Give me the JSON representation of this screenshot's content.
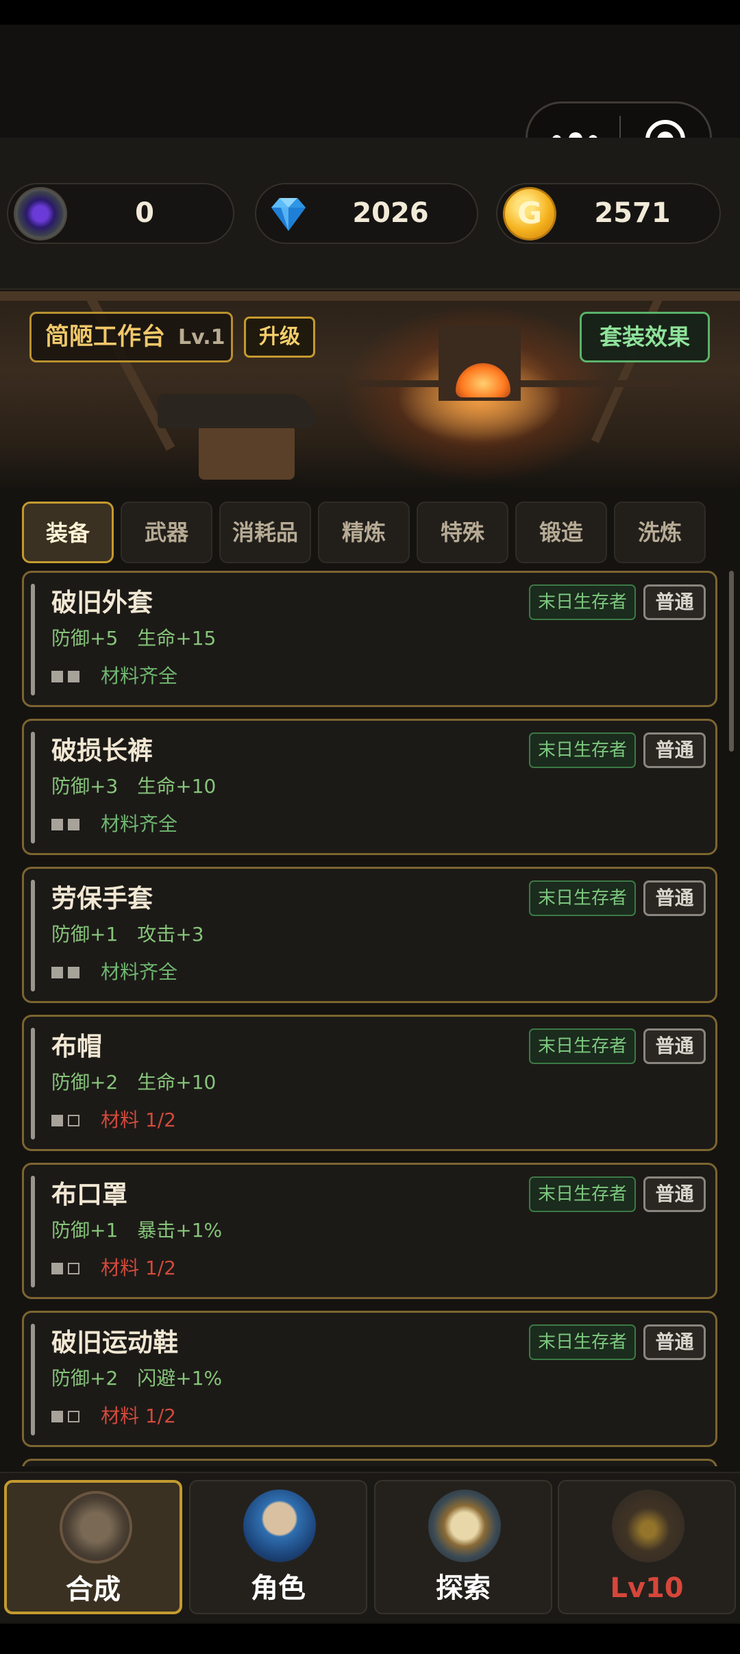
{
  "colors": {
    "accent_gold": "#c49a2f",
    "set_green": "#5ab36a",
    "stat_green": "#86c47a",
    "lack_red": "#d14a3c"
  },
  "resources": [
    {
      "icon": "crystal-icon",
      "value": "0"
    },
    {
      "icon": "diamond-icon",
      "value": "2026"
    },
    {
      "icon": "gold-coin-icon",
      "value": "2571",
      "glyph": "G"
    }
  ],
  "workbench": {
    "name": "简陋工作台",
    "level": "Lv.1",
    "upgrade_label": "升级",
    "set_effect_label": "套装效果"
  },
  "tabs": [
    "装备",
    "武器",
    "消耗品",
    "精炼",
    "特殊",
    "锻造",
    "洗炼"
  ],
  "active_tab": 0,
  "items": [
    {
      "name": "破旧外套",
      "stats": [
        "防御+5",
        "生命+15"
      ],
      "materials": "材料齐全",
      "filled": 2,
      "set": "末日生存者",
      "grade": "普通"
    },
    {
      "name": "破损长裤",
      "stats": [
        "防御+3",
        "生命+10"
      ],
      "materials": "材料齐全",
      "filled": 2,
      "set": "末日生存者",
      "grade": "普通"
    },
    {
      "name": "劳保手套",
      "stats": [
        "防御+1",
        "攻击+3"
      ],
      "materials": "材料齐全",
      "filled": 2,
      "set": "末日生存者",
      "grade": "普通"
    },
    {
      "name": "布帽",
      "stats": [
        "防御+2",
        "生命+10"
      ],
      "materials": "材料 1/2",
      "filled": 1,
      "set": "末日生存者",
      "grade": "普通"
    },
    {
      "name": "布口罩",
      "stats": [
        "防御+1",
        "暴击+1%"
      ],
      "materials": "材料 1/2",
      "filled": 1,
      "set": "末日生存者",
      "grade": "普通"
    },
    {
      "name": "破旧运动鞋",
      "stats": [
        "防御+2",
        "闪避+1%"
      ],
      "materials": "材料 1/2",
      "filled": 1,
      "set": "末日生存者",
      "grade": "普通"
    }
  ],
  "nav": [
    {
      "label": "合成",
      "icon": "crafting-icon",
      "active": true
    },
    {
      "label": "角色",
      "icon": "character-portrait-icon",
      "active": false
    },
    {
      "label": "探索",
      "icon": "compass-icon",
      "active": false
    },
    {
      "label": "Lv10",
      "icon": "locked-shop-icon",
      "active": false,
      "locked": true
    }
  ]
}
